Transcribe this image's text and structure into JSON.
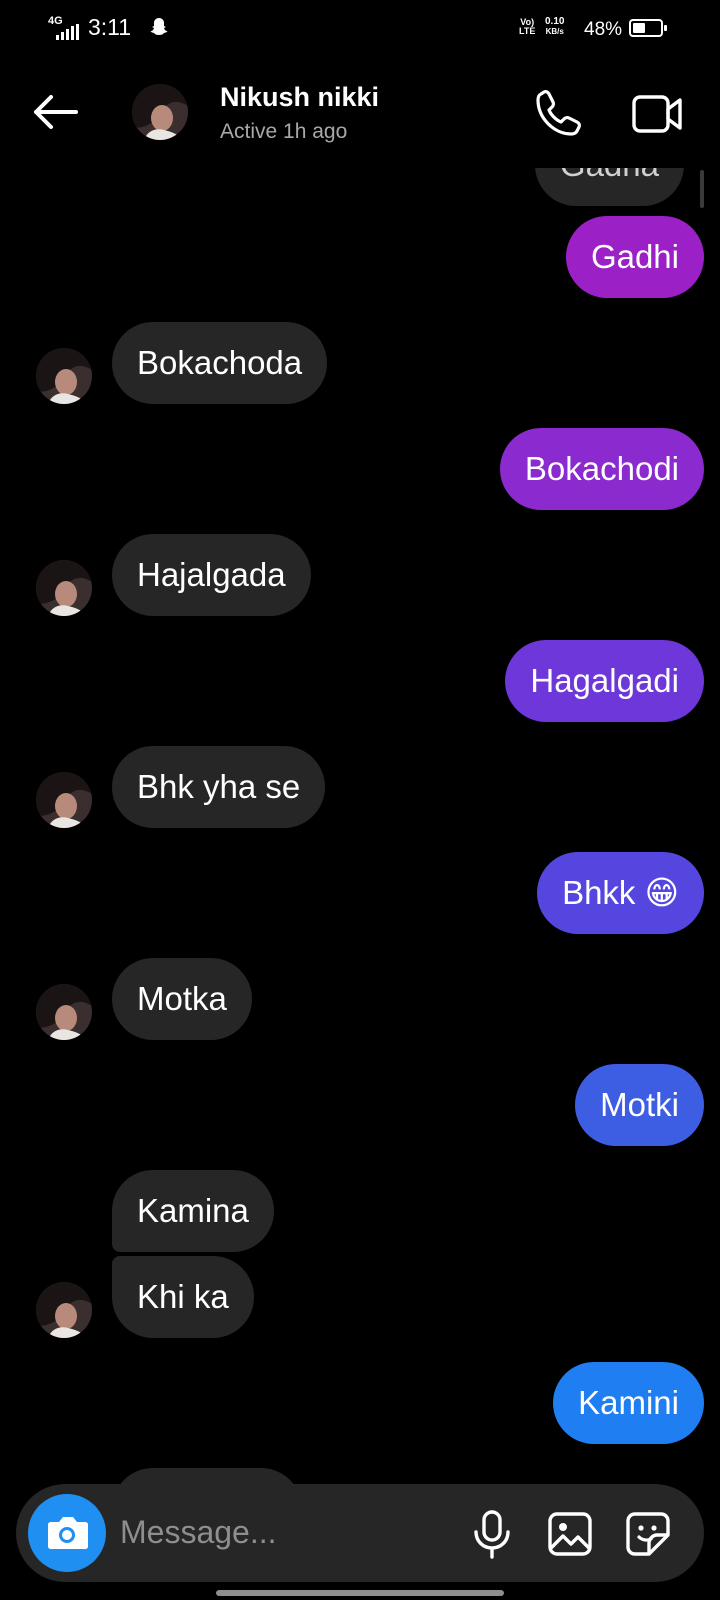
{
  "status_bar": {
    "network": "4G",
    "time": "3:11",
    "volte_top": "Vo)",
    "volte_bottom": "LTE",
    "speed_value": "0.10",
    "speed_unit": "KB/s",
    "battery": "48%",
    "battery_level": 0.48
  },
  "header": {
    "contact_name": "Nikush nikki",
    "contact_status": "Active 1h ago"
  },
  "messages": [
    {
      "side": "out",
      "text": "Gadha",
      "note": "partially scrolled under header"
    },
    {
      "side": "out",
      "text": "Gadhi"
    },
    {
      "side": "in",
      "text": "Bokachoda"
    },
    {
      "side": "out",
      "text": "Bokachodi"
    },
    {
      "side": "in",
      "text": "Hajalgada"
    },
    {
      "side": "out",
      "text": "Hagalgadi"
    },
    {
      "side": "in",
      "text": "Bhk yha se"
    },
    {
      "side": "out",
      "text": "Bhkk 😁"
    },
    {
      "side": "in",
      "text": "Motka"
    },
    {
      "side": "out",
      "text": "Motki"
    },
    {
      "side": "in",
      "text": "Kamina"
    },
    {
      "side": "in",
      "text": "Khi ka"
    },
    {
      "side": "out",
      "text": "Kamini"
    }
  ],
  "composer": {
    "placeholder": "Message..."
  },
  "colors": {
    "incoming_bubble": "#262626",
    "outgoing_gradient": [
      "#9b20c6",
      "#7e2ed9",
      "#5a4ae0",
      "#3d63e6",
      "#1e7ef2"
    ],
    "camera_button": "#1f8ff2",
    "background": "#000000"
  }
}
